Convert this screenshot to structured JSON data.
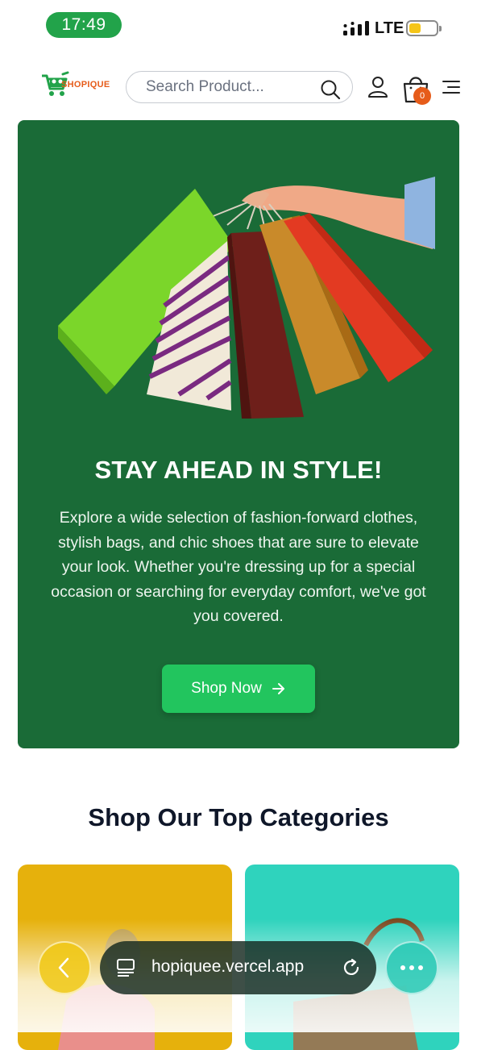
{
  "status_bar": {
    "time": "17:49",
    "network": "LTE",
    "battery_level": 0.45,
    "colors": {
      "time_pill": "#22a34a",
      "battery_fill": "#f5c518"
    }
  },
  "header": {
    "logo_text": "SHOPIQUE",
    "search_placeholder": "Search Product...",
    "cart_count": "0",
    "colors": {
      "brand_orange": "#e65c1a",
      "brand_green": "#22a34a"
    },
    "icons": [
      "search-icon",
      "user-icon",
      "shopping-bag-icon",
      "menu-icon"
    ]
  },
  "hero": {
    "title": "STAY AHEAD IN STYLE!",
    "description": "Explore a wide selection of fashion-forward clothes, stylish bags, and chic shoes that are sure to elevate your look. Whether you're dressing up for a special occasion or searching for everyday comfort, we've got you covered.",
    "cta_label": "Shop Now",
    "colors": {
      "background": "#1a6b37",
      "cta": "#22c55e"
    }
  },
  "categories": {
    "title": "Shop Our Top Categories",
    "cards": [
      {
        "color": "#e6b10c"
      },
      {
        "color": "#2fd3bd"
      }
    ]
  },
  "browser_bar": {
    "url": "hopiquee.vercel.app",
    "icons": [
      "back-chevron-icon",
      "tabs-icon",
      "reload-icon",
      "more-dots-icon"
    ]
  }
}
